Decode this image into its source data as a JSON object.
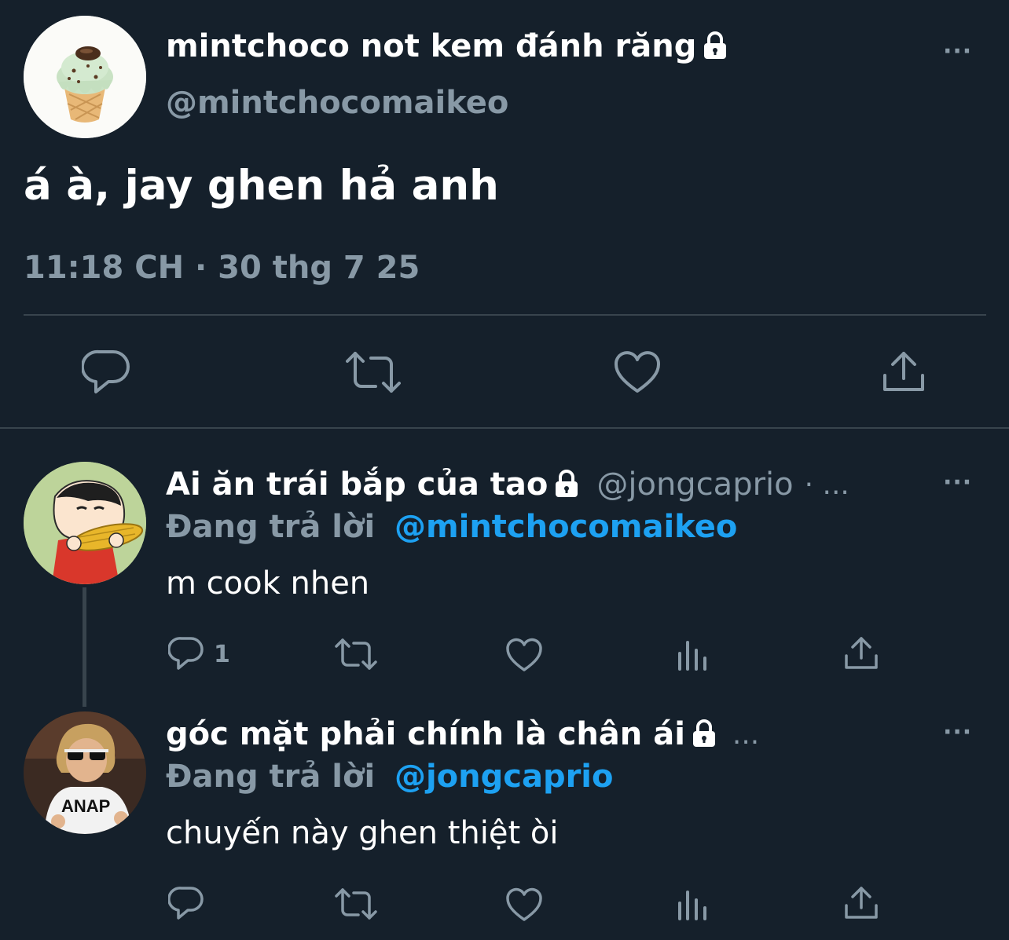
{
  "main_tweet": {
    "display_name": "mintchoco not kem đánh răng",
    "handle": "@mintchocomaikeo",
    "text": "á à, jay ghen hả anh",
    "timestamp": "11:18 CH · 30 thg 7 25",
    "more": "···"
  },
  "replies": [
    {
      "display_name": "Ai ăn trái bắp của tao",
      "handle": "@jongcaprio",
      "handle_suffix": "· ...",
      "replying_prefix": "Đang trả lời",
      "replying_to": "@mintchocomaikeo",
      "text": "m cook nhen",
      "reply_count": "1",
      "more": "···"
    },
    {
      "display_name": "góc mặt phải chính là chân ái",
      "handle_suffix": "...",
      "replying_prefix": "Đang trả lời",
      "replying_to": "@jongcaprio",
      "text": "chuyến này ghen thiệt òi",
      "more": "···"
    }
  ],
  "avatar_shirt_text": "ANAP",
  "colors": {
    "background": "#15202b",
    "muted": "#8899a6",
    "link": "#1da1f2",
    "divider": "#38444d"
  },
  "icons": [
    "lock-icon",
    "reply-icon",
    "retweet-icon",
    "like-icon",
    "share-icon",
    "analytics-icon",
    "more-icon"
  ]
}
